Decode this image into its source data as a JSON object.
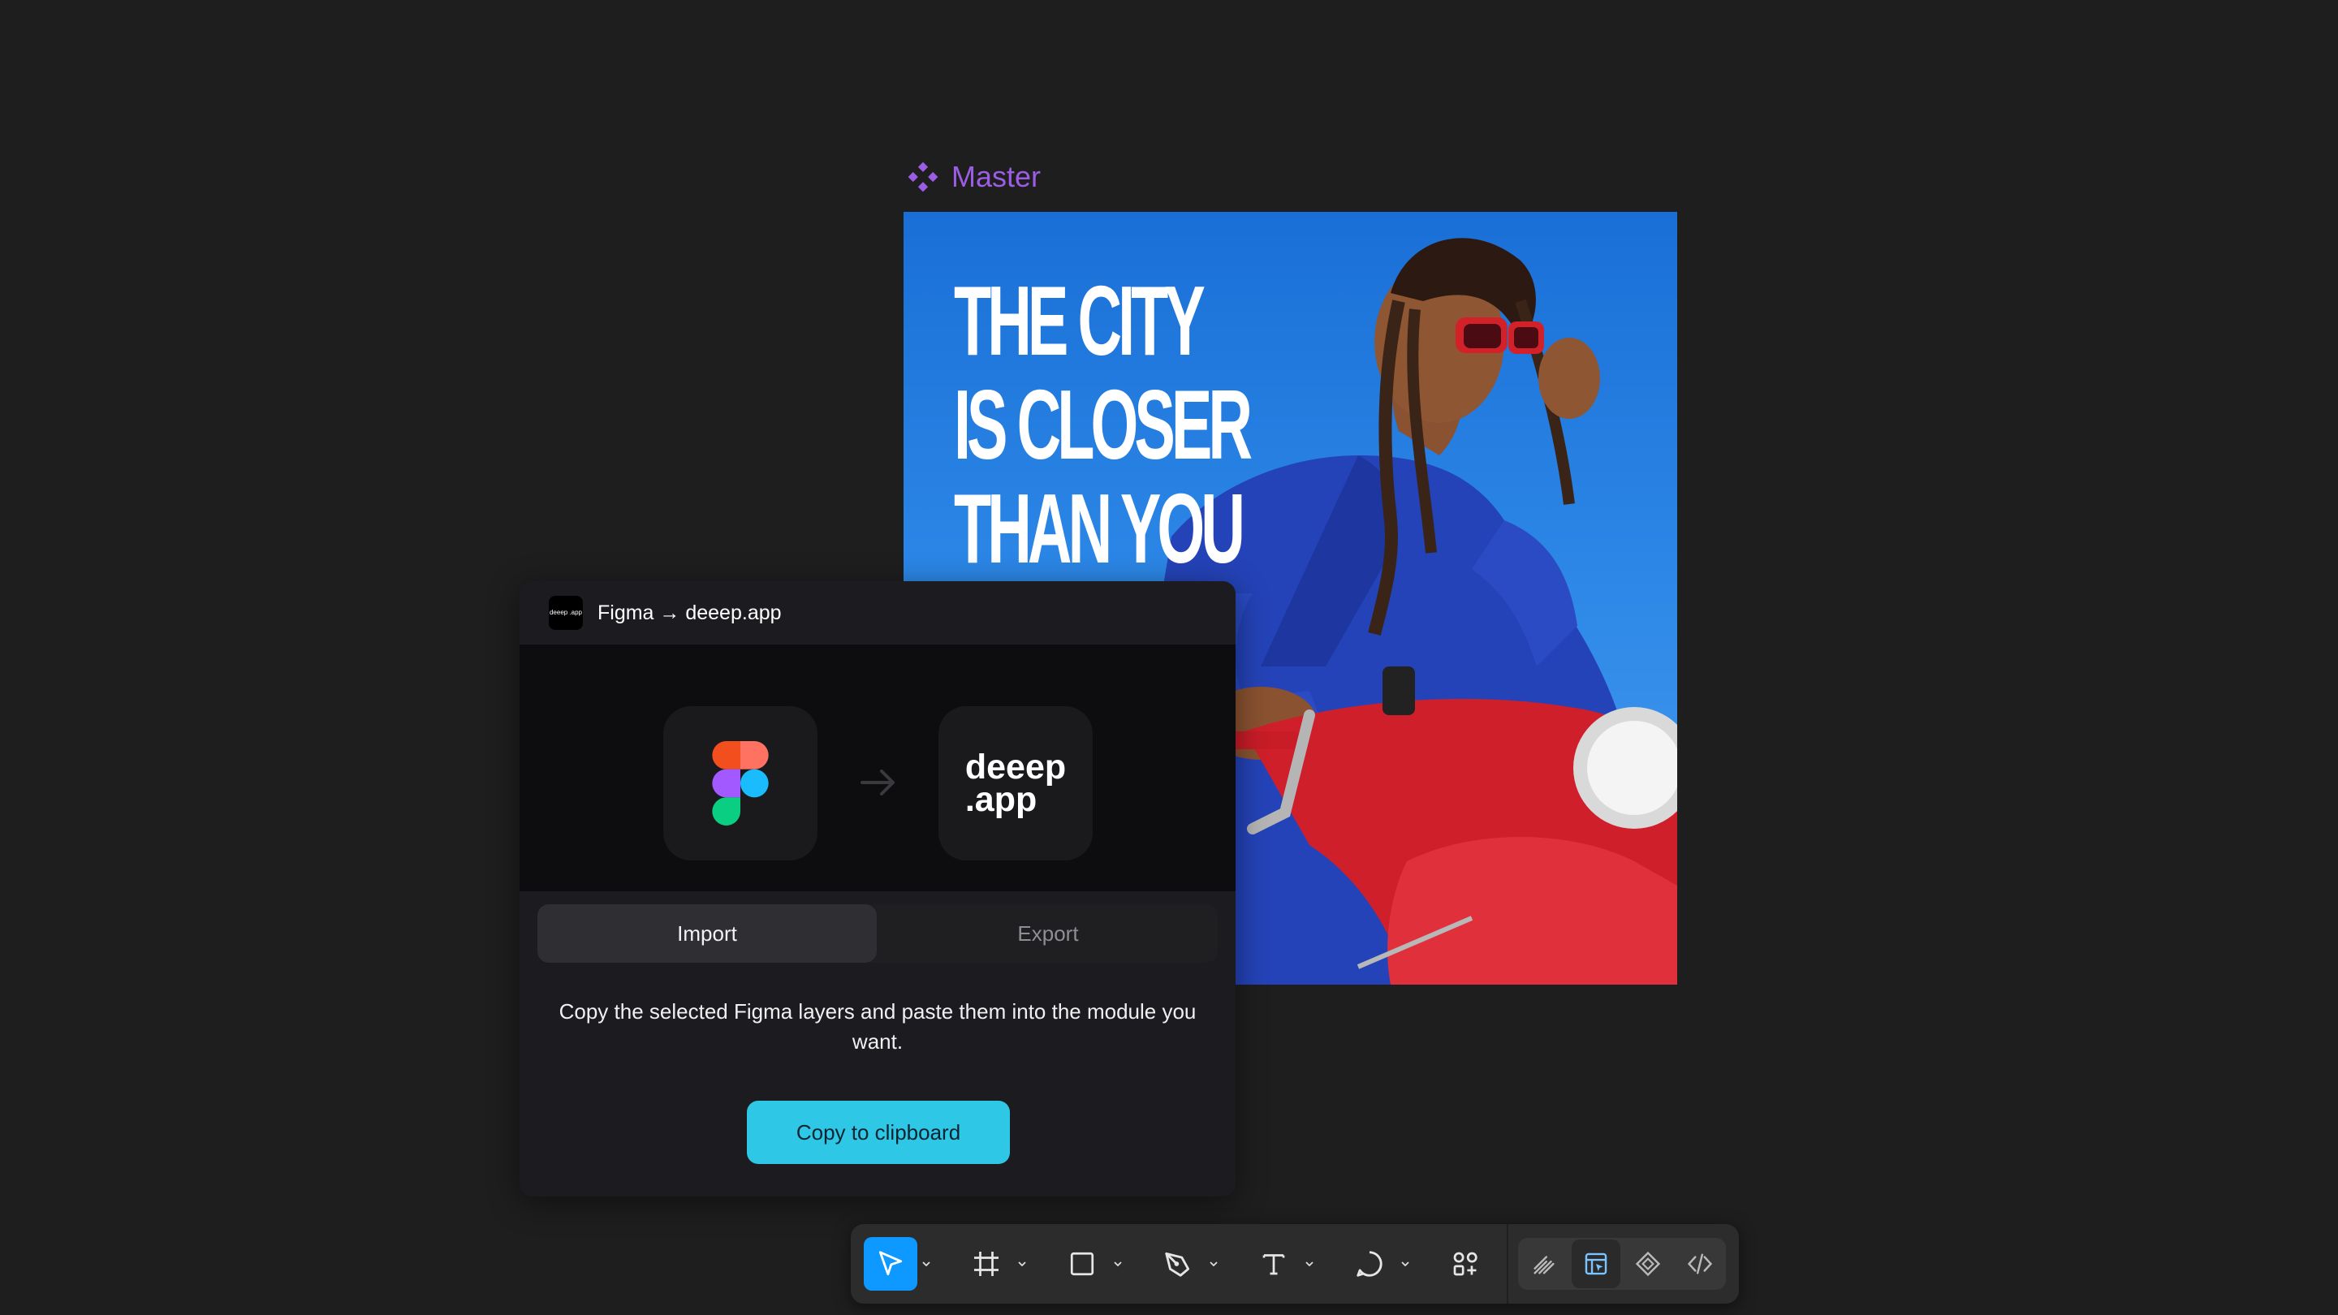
{
  "canvas": {
    "background": "#1e1e1e"
  },
  "frame": {
    "label": "Master",
    "label_color": "#9b5de5",
    "icon": "component-icon"
  },
  "poster": {
    "headline": [
      "THE CITY",
      "IS CLOSER",
      "THAN YOU"
    ],
    "image": "woman-on-red-scooter-photo"
  },
  "plugin": {
    "app_icon_text": "deeep .app",
    "title": "Figma → deeep.app",
    "hero": {
      "source_icon": "figma-logo-icon",
      "arrow_icon": "arrow-right-icon",
      "target_text_line1": "deeep",
      "target_text_line2": ".app"
    },
    "tabs": [
      {
        "label": "Import",
        "active": true
      },
      {
        "label": "Export",
        "active": false
      }
    ],
    "description": "Copy the selected Figma layers and paste them into the module you want.",
    "button_label": "Copy to clipboard",
    "button_color": "#2fc7e6"
  },
  "toolbar": {
    "tools": [
      {
        "name": "move-tool",
        "icon": "cursor-icon",
        "active": true,
        "has_caret": true
      },
      {
        "name": "frame-tool",
        "icon": "frame-hash-icon",
        "active": false,
        "has_caret": true
      },
      {
        "name": "shape-tool",
        "icon": "rectangle-icon",
        "active": false,
        "has_caret": true
      },
      {
        "name": "pen-tool",
        "icon": "pen-icon",
        "active": false,
        "has_caret": true
      },
      {
        "name": "text-tool",
        "icon": "text-t-icon",
        "active": false,
        "has_caret": true
      },
      {
        "name": "comment-tool",
        "icon": "comment-bubble-icon",
        "active": false,
        "has_caret": true
      },
      {
        "name": "actions-tool",
        "icon": "shapes-plus-icon",
        "active": false,
        "has_caret": false
      }
    ],
    "mode_buttons": [
      {
        "name": "draw-mode",
        "icon": "draw-pencil-icon"
      },
      {
        "name": "design-mode",
        "icon": "design-layout-icon",
        "selected": true
      },
      {
        "name": "components-mode",
        "icon": "component-diamond-icon"
      },
      {
        "name": "dev-mode",
        "icon": "code-brackets-icon"
      }
    ],
    "accent": "#0d99ff"
  }
}
